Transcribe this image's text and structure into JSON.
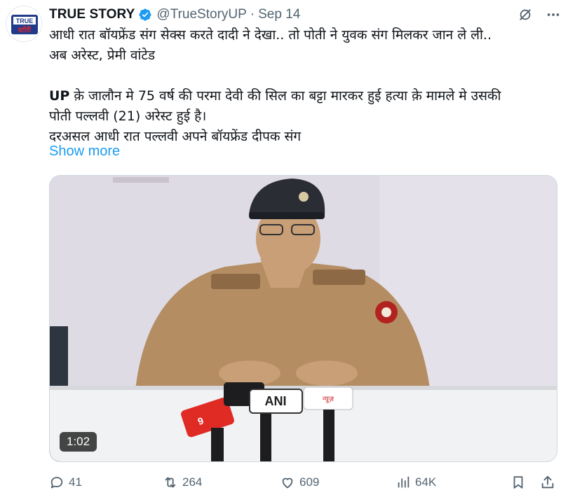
{
  "tweet": {
    "author_name": "TRUE STORY",
    "handle": "@TrueStoryUP",
    "separator": "·",
    "date": "Sep 14",
    "text_lines": [
      "आधी रात बॉयफ्रेंड संग सेक्स करते दादी ने देखा.. तो पोती ने युवक संग मिलकर जान ले ली..",
      "अब अरेस्ट, प्रेमी वांटेड"
    ],
    "para2_bold": "UP",
    "para2_line1": " क़े जालौन मे 75 वर्ष की परमा देवी की सिल का बट्टा मारकर हुई हत्या क़े मामले मे उसकी",
    "para2_line2": "पोती पल्लवी (21) अरेस्ट हुई है।",
    "para2_line3": "दरअसल आधी रात पल्लवी अपने बॉयफ्रेंड दीपक संग",
    "show_more": "Show more",
    "avatar_text_top": "TRUE",
    "avatar_text_bottom": "स्टोरी"
  },
  "media": {
    "duration": "1:02",
    "mic_labels": {
      "ani": "ANI",
      "left": "9",
      "right": "न्यूज़"
    }
  },
  "actions": {
    "replies": "41",
    "reposts": "264",
    "likes": "609",
    "views": "64K"
  },
  "icons": {
    "verified": "verified-badge-icon",
    "grok": "grok-icon",
    "more": "more-icon",
    "reply": "reply-icon",
    "repost": "repost-icon",
    "like": "like-icon",
    "views": "views-icon",
    "bookmark": "bookmark-icon",
    "share": "share-icon"
  },
  "colors": {
    "accent": "#1d9bf0",
    "muted": "#536471",
    "text": "#0f1419"
  }
}
